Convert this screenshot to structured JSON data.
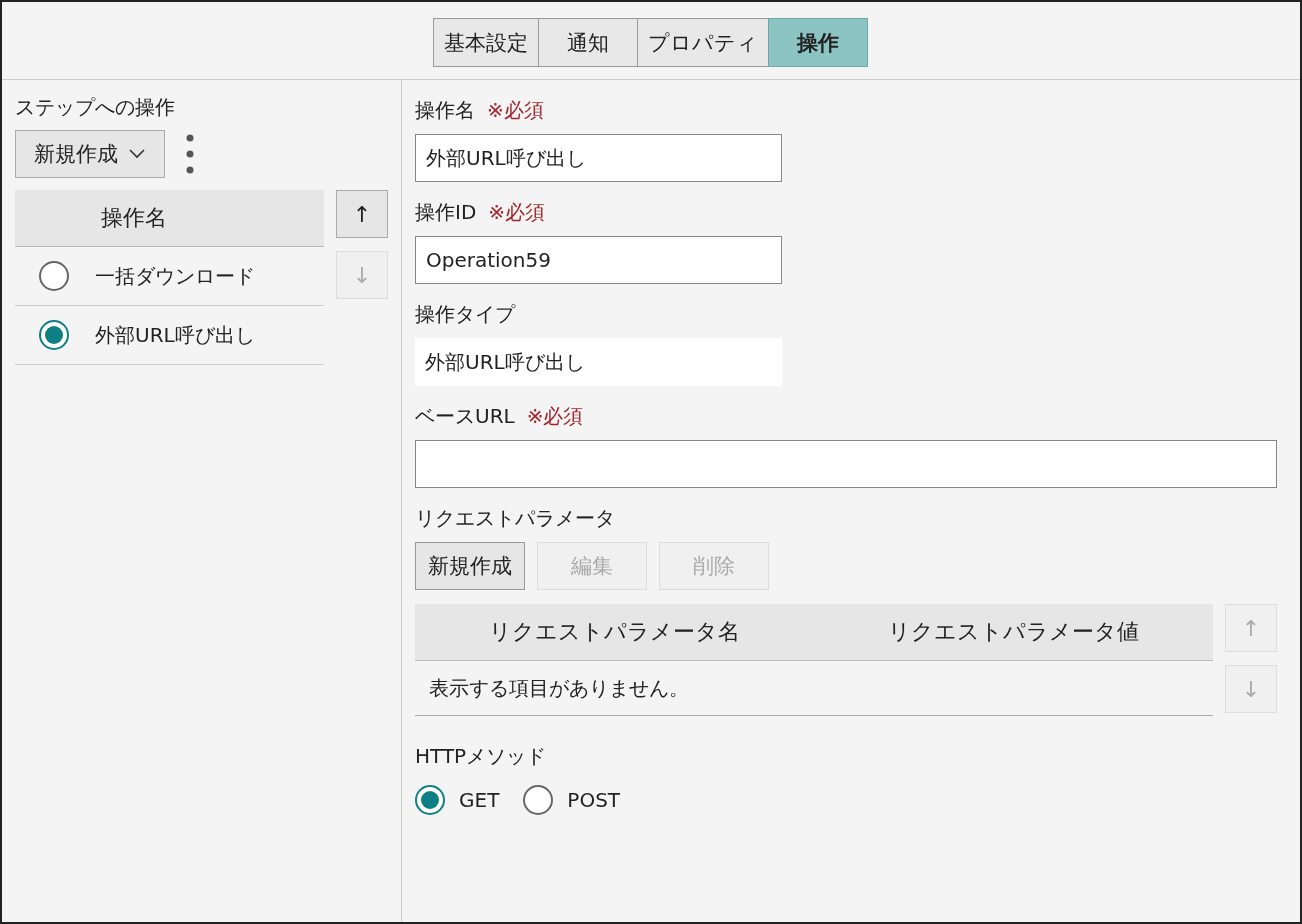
{
  "tabs": [
    {
      "label": "基本設定",
      "selected": false
    },
    {
      "label": "通知",
      "selected": false
    },
    {
      "label": "プロパティ",
      "selected": false
    },
    {
      "label": "操作",
      "selected": true
    }
  ],
  "left": {
    "title": "ステップへの操作",
    "dropdown": "新規作成",
    "table": {
      "column": "操作名",
      "rows": [
        {
          "label": "一括ダウンロード",
          "selected": false
        },
        {
          "label": "外部URL呼び出し",
          "selected": true
        }
      ]
    },
    "move_up": {
      "label": "↑",
      "disabled": false
    },
    "move_down": {
      "label": "↓",
      "disabled": true
    }
  },
  "fields": [
    {
      "kind": "input",
      "label": "操作名",
      "required": "※必須",
      "value": "外部URL呼び出し"
    },
    {
      "kind": "input",
      "label": "操作ID",
      "required": "※必須",
      "value": "Operation59"
    },
    {
      "kind": "readonly",
      "label": "操作タイプ",
      "value": "外部URL呼び出し"
    },
    {
      "kind": "wide",
      "label": "ベースURL",
      "required": "※必須"
    }
  ],
  "params": {
    "label": "リクエストパラメータ",
    "buttons": [
      {
        "label": "新規作成",
        "disabled": false
      },
      {
        "label": "編集",
        "disabled": true
      },
      {
        "label": "削除",
        "disabled": true
      }
    ],
    "columns": [
      "リクエストパラメータ名",
      "リクエストパラメータ値"
    ],
    "empty": "表示する項目がありません。",
    "move_up": {
      "label": "↑",
      "disabled": true
    },
    "move_down": {
      "label": "↓",
      "disabled": true
    }
  },
  "http": {
    "label": "HTTPメソッド",
    "options": [
      {
        "label": "GET",
        "selected": true
      },
      {
        "label": "POST",
        "selected": false
      }
    ]
  }
}
